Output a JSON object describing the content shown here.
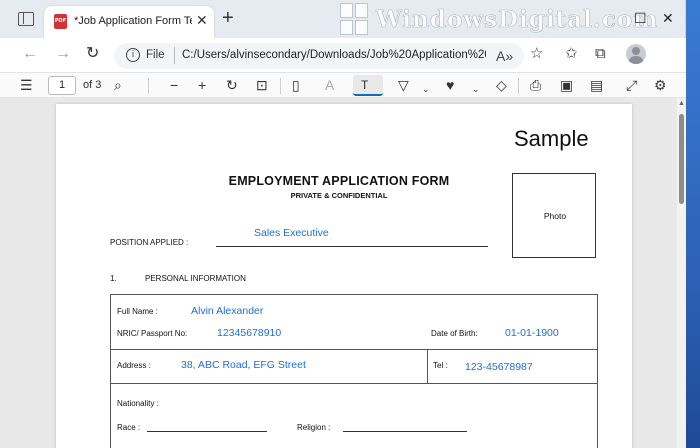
{
  "tab": {
    "title": "*Job Application Form Template",
    "pdf_badge": "PDF"
  },
  "brand": {
    "text": "WindowsDigital.com"
  },
  "address_bar": {
    "scheme": "File",
    "url": "C:/Users/alvinsecondary/Downloads/Job%20Application%20Form%..."
  },
  "pdf_toolbar": {
    "page": "1",
    "page_count": "of 3"
  },
  "document": {
    "watermark": "Sample",
    "title": "EMPLOYMENT APPLICATION FORM",
    "subtitle": "PRIVATE & CONFIDENTIAL",
    "photo_label": "Photo",
    "position_label": "POSITION APPLIED :",
    "position_value": "Sales Executive",
    "section_number": "1.",
    "section_title": "PERSONAL INFORMATION",
    "full_name_label": "Full Name :",
    "full_name_value": "Alvin Alexander",
    "nric_label": "NRIC/ Passport No:",
    "nric_value": "12345678910",
    "dob_label": "Date of Birth:",
    "dob_value": "01-01-1900",
    "address_label": "Address :",
    "address_value": "38, ABC Road, EFG Street",
    "tel_label": "Tel :",
    "tel_value": "123-45678987",
    "nationality_label": "Nationality :",
    "race_label": "Race :",
    "religion_label": "Religion :"
  },
  "colors": {
    "field_value": "#1f6ed4",
    "accent": "#0f6cbd",
    "pdf_badge": "#d13438"
  }
}
